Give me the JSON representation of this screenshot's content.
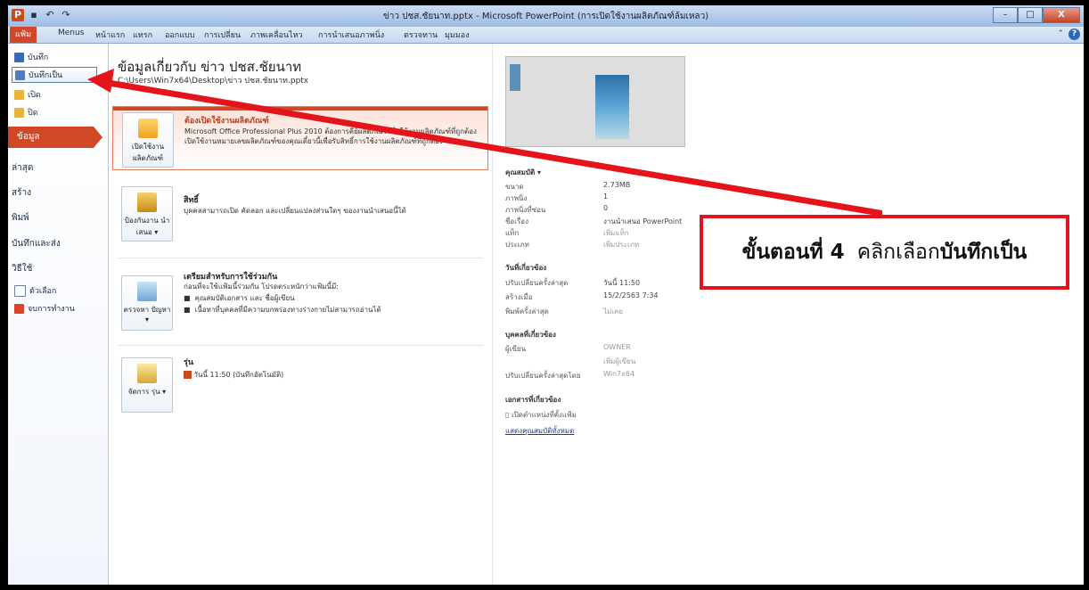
{
  "window": {
    "title": "ข่าว ปชส.ชัยนาท.pptx - Microsoft PowerPoint (การเปิดใช้งานผลิตภัณฑ์ล้มเหลว)",
    "qat_app": "P",
    "minimize": "–",
    "maximize": "□",
    "close": "X"
  },
  "ribbon": {
    "tabs": [
      "แฟ้ม",
      "Menus",
      "หน้าแรก",
      "แทรก",
      "ออกแบบ",
      "การเปลี่ยน",
      "ภาพเคลื่อนไหว",
      "การนำเสนอภาพนิ่ง",
      "ตรวจทาน",
      "มุมมอง"
    ],
    "help": "?"
  },
  "nav": {
    "save": "บันทึก",
    "save_as": "บันทึกเป็น",
    "open": "เปิด",
    "close": "ปิด",
    "info": "ข้อมูล",
    "recent": "ล่าสุด",
    "new": "สร้าง",
    "print": "พิมพ์",
    "save_send": "บันทึกและส่ง",
    "help": "วิธีใช้",
    "options": "ตัวเลือก",
    "exit": "จบการทำงาน"
  },
  "info": {
    "title": "ข้อมูลเกี่ยวกับ ข่าว ปชส.ชัยนาท",
    "path": "C:\\Users\\Win7x64\\Desktop\\ข่าว ปชส.ชัยนาท.pptx",
    "activation": {
      "title": "ต้องเปิดใช้งานผลิตภัณฑ์",
      "desc": "Microsoft Office Professional Plus 2010 ต้องการคีย์ผลิตภัณฑ์เพื่อใช้งานผลิตภัณฑ์ที่ถูกต้อง เปิดใช้งานหมายเลขผลิตภัณฑ์ของคุณเดี๋ยวนี้เพื่อรับสิทธิ์การใช้งานผลิตภัณฑ์ที่ถูกต้อง",
      "button": "เปิดใช้งาน ผลิตภัณฑ์"
    },
    "permissions": {
      "title": "สิทธิ์",
      "desc": "บุคคลสามารถเปิด คัดลอก และเปลี่ยนแปลงส่วนใดๆ ของงานนำเสนอนี้ได้",
      "button": "ป้องกันงาน นำเสนอ ▾"
    },
    "prepare": {
      "title": "เตรียมสำหรับการใช้ร่วมกัน",
      "desc": "ก่อนที่จะใช้แฟ้มนี้ร่วมกัน โปรดตระหนักว่าแฟ้มนี้มี:",
      "bullets": [
        "คุณสมบัติเอกสาร และ ชื่อผู้เขียน",
        "เนื้อหาที่บุคคลที่มีความบกพร่องทางร่างกายไม่สามารถอ่านได้"
      ],
      "button": "ตรวจหา ปัญหา ▾"
    },
    "versions": {
      "title": "รุ่น",
      "item": "วันนี้ 11:50 (บันทึกอัตโนมัติ)",
      "button": "จัดการ รุ่น ▾"
    }
  },
  "properties": {
    "header": "คุณสมบัติ ▾",
    "size_label": "ขนาด",
    "size": "2.73MB",
    "slides_label": "ภาพนิ่ง",
    "slides": "1",
    "hidden_label": "ภาพนิ่งที่ซ่อน",
    "hidden": "0",
    "title_label": "ชื่อเรื่อง",
    "title": "งานนำเสนอ PowerPoint",
    "tags_label": "แท็ก",
    "tags": "เพิ่มแท็ก",
    "category_label": "ประเภท",
    "category": "เพิ่มประเภท",
    "dates_header": "วันที่เกี่ยวข้อง",
    "modified_label": "ปรับเปลี่ยนครั้งล่าสุด",
    "modified": "วันนี้ 11:50",
    "created_label": "สร้างเมื่อ",
    "created": "15/2/2563 7:34",
    "printed_label": "พิมพ์ครั้งล่าสุด",
    "printed": "ไม่เคย",
    "people_header": "บุคคลที่เกี่ยวข้อง",
    "author_label": "ผู้เขียน",
    "author": "OWNER",
    "add_author": "เพิ่มผู้เขียน",
    "lastmod_label": "ปรับเปลี่ยนครั้งล่าสุดโดย",
    "lastmod": "Win7x64",
    "docs_header": "เอกสารที่เกี่ยวข้อง",
    "open_location": "เปิดตำแหน่งที่ตั้งแฟ้ม",
    "show_all": "แสดงคุณสมบัติทั้งหมด"
  },
  "callout": {
    "step": "ขั้นตอนที่ 4",
    "text": "คลิกเลือก",
    "action": "บันทึกเป็น"
  },
  "colors": {
    "accent": "#d24726",
    "callout_red": "#e5131b"
  }
}
